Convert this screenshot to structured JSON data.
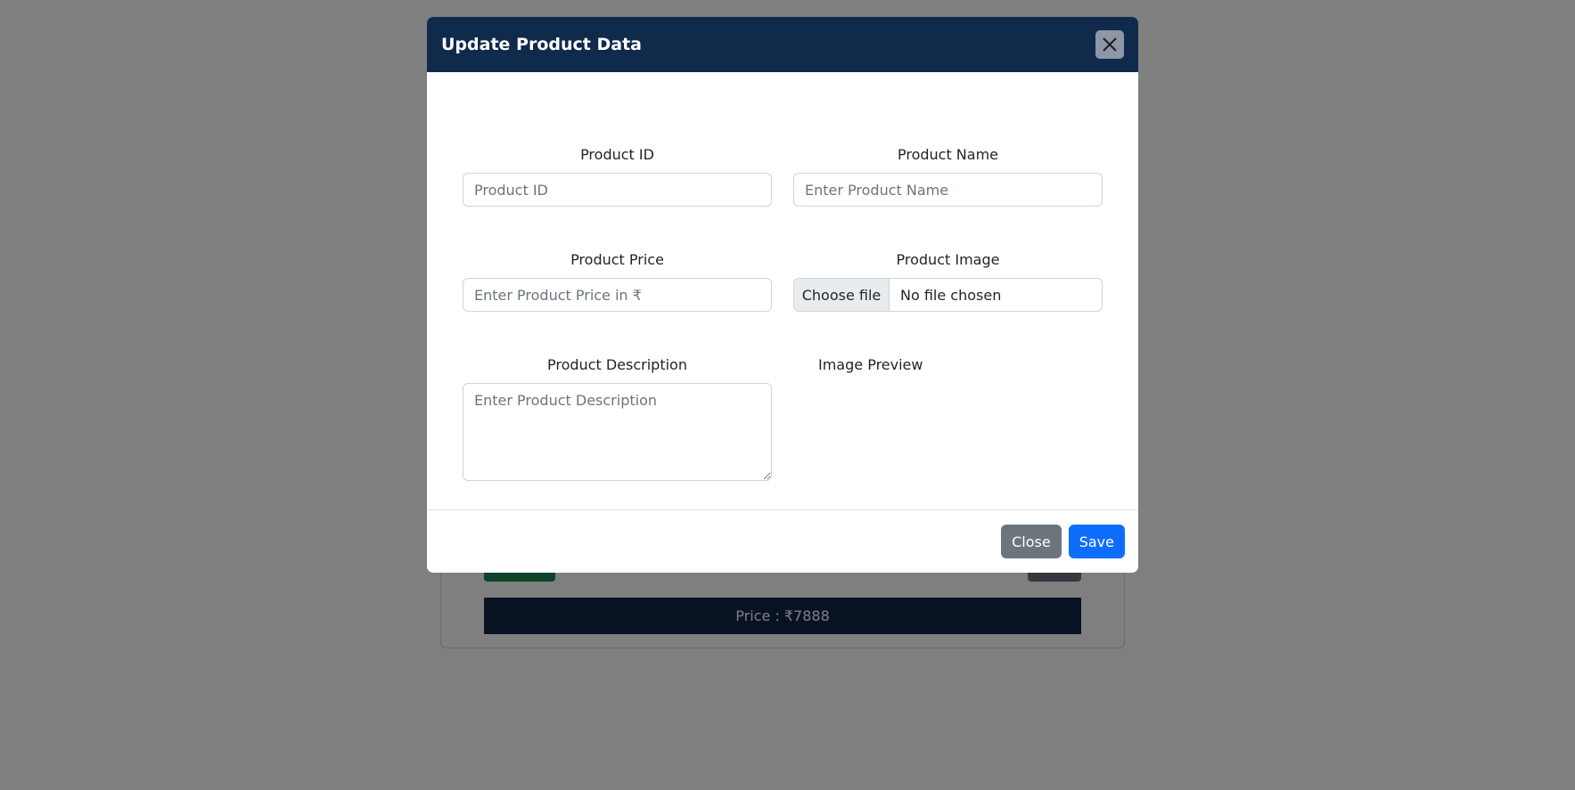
{
  "background": {
    "price_label": "Price : ₹7888"
  },
  "modal": {
    "title": "Update Product Data",
    "fields": {
      "product_id": {
        "label": "Product ID",
        "placeholder": "Product ID"
      },
      "product_name": {
        "label": "Product Name",
        "placeholder": "Enter Product Name"
      },
      "product_price": {
        "label": "Product Price",
        "placeholder": "Enter Product Price in ₹"
      },
      "product_image": {
        "label": "Product Image",
        "button": "Choose file",
        "status": "No file chosen"
      },
      "product_description": {
        "label": "Product Description",
        "placeholder": "Enter Product Description"
      },
      "image_preview": {
        "label": "Image Preview"
      }
    },
    "footer": {
      "close_label": "Close",
      "save_label": "Save"
    }
  },
  "colors": {
    "header_bg": "#102a4c",
    "save_button": "#0d6efd",
    "close_button": "#6c757d"
  }
}
